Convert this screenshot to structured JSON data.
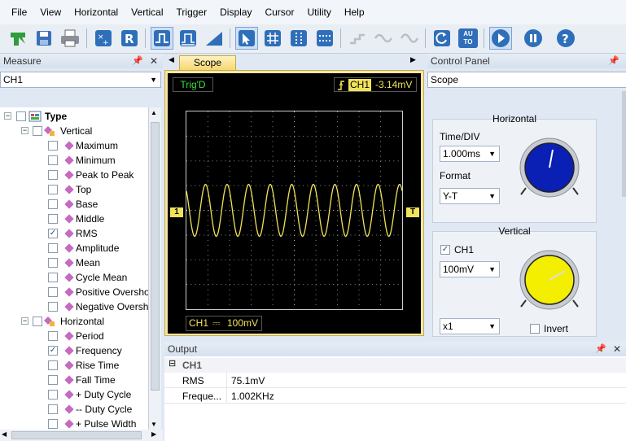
{
  "menu": [
    "File",
    "View",
    "Horizontal",
    "Vertical",
    "Trigger",
    "Display",
    "Cursor",
    "Utility",
    "Help"
  ],
  "toolbar_icons": [
    "open-icon",
    "save-icon",
    "print-icon",
    "measure-add-icon",
    "ref-icon",
    "pulse-mode-icon",
    "pulse-step-icon",
    "ramp-icon",
    "pointer-icon",
    "grid-icon",
    "cursor-vertical-icon",
    "cursor-horizontal-icon",
    "step-wave-icon",
    "sine-wave-icon",
    "sine-wave-2-icon",
    "rotate-icon",
    "auto-icon",
    "run-icon",
    "pause-icon",
    "help-icon"
  ],
  "auto_label": "AU TO",
  "measure": {
    "title": "Measure",
    "channel": "CH1",
    "tree": {
      "root": "Type",
      "vertical": {
        "label": "Vertical",
        "items": [
          {
            "label": "Maximum",
            "checked": false
          },
          {
            "label": "Minimum",
            "checked": false
          },
          {
            "label": "Peak to Peak",
            "checked": false
          },
          {
            "label": "Top",
            "checked": false
          },
          {
            "label": "Base",
            "checked": false
          },
          {
            "label": "Middle",
            "checked": false
          },
          {
            "label": "RMS",
            "checked": true
          },
          {
            "label": "Amplitude",
            "checked": false
          },
          {
            "label": "Mean",
            "checked": false
          },
          {
            "label": "Cycle Mean",
            "checked": false
          },
          {
            "label": "Positive Oversho",
            "checked": false
          },
          {
            "label": "Negative Oversh",
            "checked": false
          }
        ]
      },
      "horizontal": {
        "label": "Horizontal",
        "items": [
          {
            "label": "Period",
            "checked": false
          },
          {
            "label": "Frequency",
            "checked": true
          },
          {
            "label": "Rise Time",
            "checked": false
          },
          {
            "label": "Fall Time",
            "checked": false
          },
          {
            "label": "+ Duty Cycle",
            "checked": false
          },
          {
            "label": "-- Duty Cycle",
            "checked": false
          },
          {
            "label": "+ Pulse Width",
            "checked": false
          }
        ]
      }
    }
  },
  "scope": {
    "tab": "Scope",
    "trig_status": "Trig'D",
    "trigger_channel": "CH1",
    "trigger_level": "-3.14mV",
    "channel_marker": "1",
    "trigger_marker": "T",
    "ch_label": "CH1",
    "coupling_symbol": "⎓",
    "volts_div": "100mV",
    "wave_color": "#f0e35a",
    "cycles_visible": 10
  },
  "control_panel": {
    "title": "Control Panel",
    "selector": "Scope",
    "horizontal": {
      "title": "Horizontal",
      "time_div_label": "Time/DIV",
      "time_div": "1.000ms",
      "format_label": "Format",
      "format": "Y-T",
      "knob_color": "#0a1fb4"
    },
    "vertical": {
      "title": "Vertical",
      "ch_label": "CH1",
      "ch_checked": true,
      "volts": "100mV",
      "probe": "x1",
      "invert_label": "Invert",
      "invert_checked": false,
      "knob_color": "#f4ee00"
    }
  },
  "output": {
    "title": "Output",
    "group": "CH1",
    "rows": [
      {
        "name": "RMS",
        "value": "75.1mV"
      },
      {
        "name": "Freque...",
        "value": "1.002KHz"
      }
    ]
  },
  "colors": {
    "accent": "#2f6fba",
    "panel": "#dfe8f3",
    "scope_frame": "#f5e6a6",
    "trace": "#f0e35a"
  }
}
